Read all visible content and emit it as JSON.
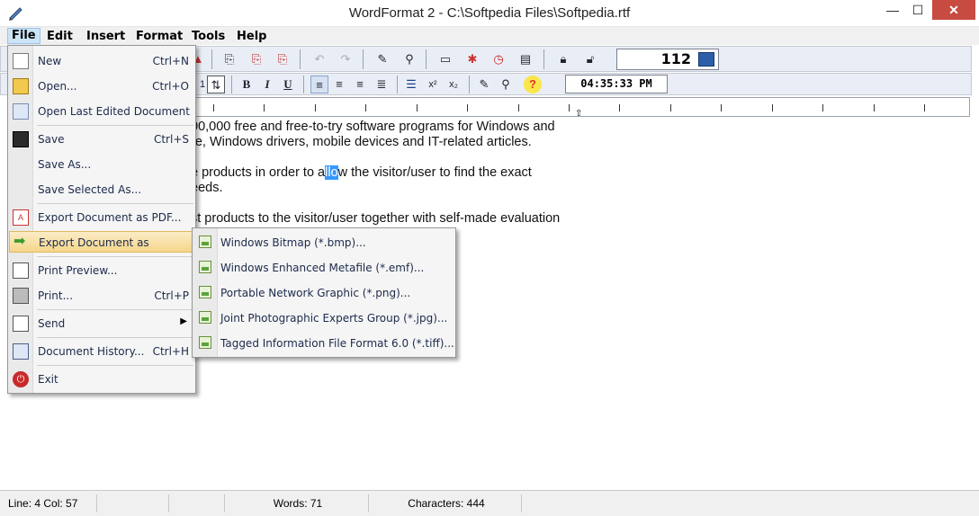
{
  "window": {
    "title": "WordFormat 2 - C:\\Softpedia Files\\Softpedia.rtf",
    "minimize": "—",
    "maximize": "☐",
    "close": "✕"
  },
  "menubar": {
    "items": [
      "File",
      "Edit",
      "Insert",
      "Format",
      "Tools",
      "Help"
    ]
  },
  "toolbar": {
    "counter_value": "112",
    "time_value": "04:35:33 PM",
    "font_size_partial": "1",
    "bold": "B",
    "italic": "I",
    "underline": "U",
    "superscript": "x²",
    "subscript": "x₂",
    "help": "?"
  },
  "file_menu": {
    "items": [
      {
        "label": "New",
        "shortcut": "Ctrl+N",
        "icon": "new-document-icon"
      },
      {
        "label": "Open...",
        "shortcut": "Ctrl+O",
        "icon": "open-folder-icon"
      },
      {
        "label": "Open Last Edited Document",
        "shortcut": "",
        "icon": "recent-document-icon"
      },
      {
        "label": "Save",
        "shortcut": "Ctrl+S",
        "icon": "floppy-disk-icon"
      },
      {
        "label": "Save As...",
        "shortcut": "",
        "icon": ""
      },
      {
        "label": "Save Selected As...",
        "shortcut": "",
        "icon": ""
      },
      {
        "label": "Export Document as PDF...",
        "shortcut": "",
        "icon": "pdf-icon"
      },
      {
        "label": "Export Document as",
        "shortcut": "",
        "icon": "green-arrow-icon"
      },
      {
        "label": "Print Preview...",
        "shortcut": "",
        "icon": "print-preview-icon"
      },
      {
        "label": "Print...",
        "shortcut": "Ctrl+P",
        "icon": "printer-icon"
      },
      {
        "label": "Send",
        "shortcut": "",
        "icon": "envelope-icon"
      },
      {
        "label": "Document History...",
        "shortcut": "Ctrl+H",
        "icon": "history-icon"
      },
      {
        "label": "Exit",
        "shortcut": "",
        "icon": "power-icon"
      }
    ]
  },
  "export_submenu": {
    "items": [
      "Windows Bitmap (*.bmp)...",
      "Windows Enhanced Metafile (*.emf)...",
      "Portable Network Graphic (*.png)...",
      "Joint Photographic Experts Group (*.jpg)...",
      "Tagged Information File Format 6.0 (*.tiff)..."
    ]
  },
  "document": {
    "line1": "00,000 free and free-to-try software programs for Windows and",
    "line2": "re, Windows drivers, mobile devices and IT-related articles.",
    "line3_pre": "e products in order to a",
    "line3_sel": "llo",
    "line3_post": "w the visitor/user to find the exact",
    "line4": "eeds.",
    "line5": "st products to the visitor/user together with self-made evaluation"
  },
  "statusbar": {
    "line_col": "Line:  4  Col:  57",
    "words": "Words: 71",
    "characters": "Characters: 444"
  },
  "colors": {
    "accent_selection": "#3399ff",
    "menu_highlight": "#f5d68b",
    "close_button": "#c74b40"
  }
}
